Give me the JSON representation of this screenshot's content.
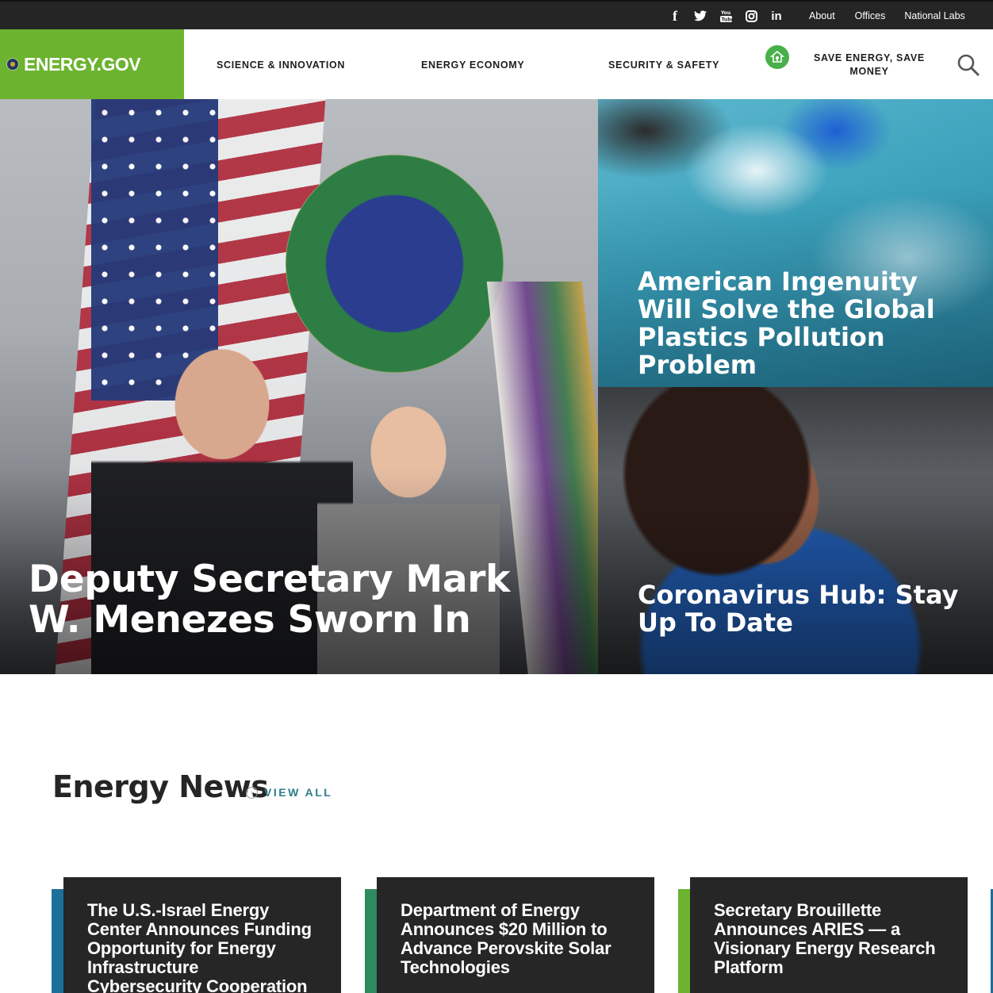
{
  "topbar": {
    "social": [
      {
        "name": "facebook-icon",
        "glyph": "f"
      },
      {
        "name": "twitter-icon",
        "glyph": "🐦"
      },
      {
        "name": "youtube-icon",
        "glyph": "▶"
      },
      {
        "name": "instagram-icon",
        "glyph": "◎"
      },
      {
        "name": "linkedin-icon",
        "glyph": "in"
      }
    ],
    "links": [
      "About",
      "Offices",
      "National Labs"
    ]
  },
  "header": {
    "logo_text": "ENERGY.GOV",
    "nav": [
      "SCIENCE & INNOVATION",
      "ENERGY ECONOMY",
      "SECURITY & SAFETY"
    ],
    "save_energy": "SAVE ENERGY, SAVE MONEY"
  },
  "hero": {
    "main_title": "Deputy Secretary Mark W. Menezes Sworn In",
    "side1_title": "American Ingenuity Will Solve the Global Plastics Pollution Problem",
    "side2_title": "Coronavirus Hub: Stay Up To Date"
  },
  "news": {
    "heading": "Energy News",
    "view_all": "VIEW ALL",
    "cards": [
      {
        "title": "The U.S.-Israel Energy Center Announces Funding Opportunity for Energy Infrastructure Cybersecurity Cooperation",
        "accent": "#1c6f99"
      },
      {
        "title": "Department of Energy Announces $20 Million to Advance Perovskite Solar Technologies",
        "accent": "#2e8b5f"
      },
      {
        "title": "Secretary Brouillette Announces ARIES — a Visionary Energy Research Platform",
        "accent": "#6cb330"
      }
    ]
  },
  "colors": {
    "brand_green": "#6cb330",
    "topbar": "#252525",
    "link_teal": "#2d7c8a",
    "card_bg": "#262626"
  }
}
